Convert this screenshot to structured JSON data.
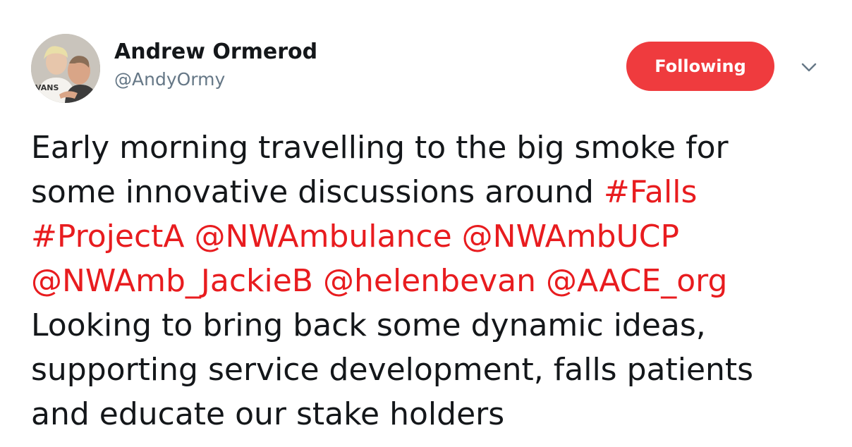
{
  "user": {
    "display_name": "Andrew Ormerod",
    "screen_name": "@AndyOrmy",
    "avatar_text": "VANS"
  },
  "follow_button": {
    "label": "Following"
  },
  "colors": {
    "accent": "#ef3b3e",
    "link": "#e81c1f",
    "text": "#14171a",
    "secondary_text": "#657786"
  },
  "icons": {
    "more": "chevron-down-icon"
  },
  "tweet": {
    "line1": {
      "t1": "Early morning travelling to the big smoke for"
    },
    "line2": {
      "t1": "some innovative discussions around ",
      "hashtag_falls": "#Falls"
    },
    "line3": {
      "hashtag_projecta": "#ProjectA",
      "sp1": " ",
      "mention_nwambulance": "@NWAmbulance",
      "sp2": " ",
      "mention_nwambucp": "@NWAmbUCP"
    },
    "line4": {
      "mention_jackieb": "@NWAmb_JackieB",
      "sp1": " ",
      "mention_helenbevan": "@helenbevan",
      "sp2": " ",
      "mention_aace": "@AACE_org"
    },
    "line5": {
      "t1": "Looking to bring back some dynamic ideas,"
    },
    "line6": {
      "t1": "supporting service development, falls patients"
    },
    "line7": {
      "t1": "and educate our stake holders"
    }
  }
}
